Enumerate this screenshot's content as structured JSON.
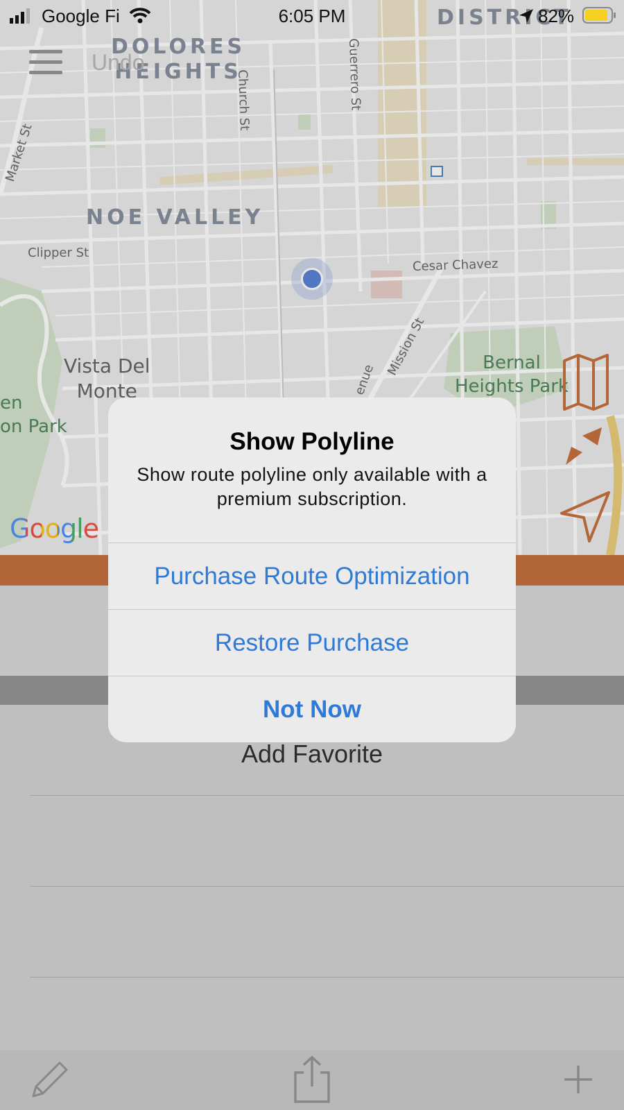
{
  "status_bar": {
    "carrier": "Google Fi",
    "time": "6:05 PM",
    "battery": "82%"
  },
  "map": {
    "labels": {
      "dolores_heights": "DOLORES\nHEIGHTS",
      "noe_valley": "NOE VALLEY",
      "vista_del_monte": "Vista Del\nMonte",
      "bernal_heights_park": "Bernal\nHeights Park",
      "district": "DISTRICT",
      "en_park": "en\non Park",
      "church_st": "Church St",
      "guerrero_st": "Guerrero St",
      "market_st": "Market St",
      "clipper_st": "Clipper St",
      "cesar_chavez": "Cesar Chavez",
      "mission_st": "Mission St",
      "avenue_fragment": "enue",
      "undo": "Undo"
    },
    "google_logo": "Google"
  },
  "list": {
    "add_favorite": "Add Favorite"
  },
  "alert": {
    "title": "Show Polyline",
    "message": "Show route polyline only available with a premium subscription.",
    "buttons": {
      "purchase": "Purchase Route Optimization",
      "restore": "Restore Purchase",
      "not_now": "Not Now"
    }
  },
  "colors": {
    "accent_orange": "#c0622a",
    "link_blue": "#2e7ad8",
    "location_dot": "#4a76d0"
  }
}
